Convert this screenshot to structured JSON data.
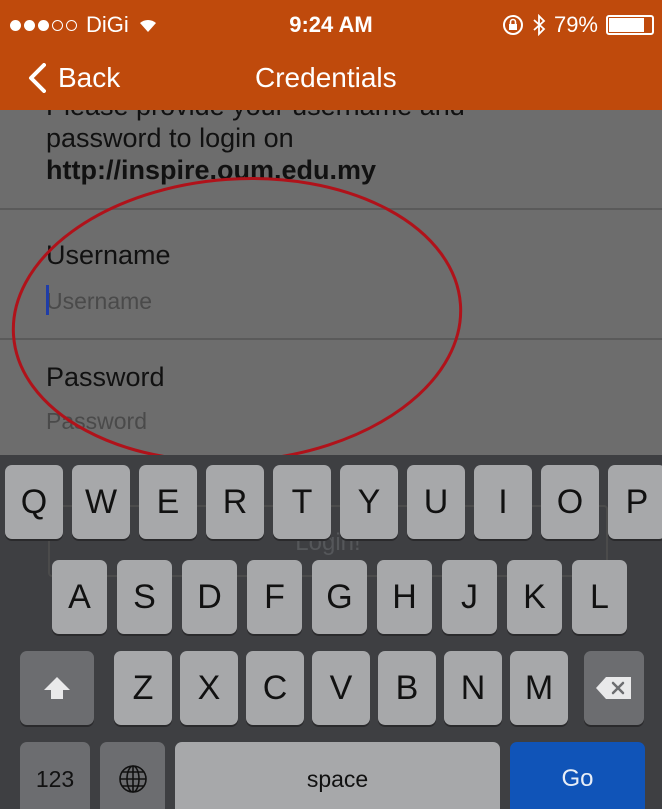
{
  "status_bar": {
    "carrier": "DiGi",
    "signal_bars_filled": 3,
    "signal_bars_total": 5,
    "time": "9:24 AM",
    "battery_percent": "79%",
    "battery_level": 0.79,
    "icons": [
      "wifi-icon",
      "rotation-lock-icon",
      "bluetooth-icon",
      "battery-icon"
    ]
  },
  "nav": {
    "back_label": "Back",
    "title": "Credentials"
  },
  "form": {
    "intro_line1": "Please provide your username and",
    "intro_line2": "password to login on",
    "intro_url": "http://inspire.oum.edu.my",
    "username_label": "Username",
    "username_placeholder": "Username",
    "password_label": "Password",
    "password_placeholder": "Password",
    "login_button": "Login!"
  },
  "annotation": {
    "color": "#b0121a"
  },
  "keyboard": {
    "row1": [
      "Q",
      "W",
      "E",
      "R",
      "T",
      "Y",
      "U",
      "I",
      "O",
      "P"
    ],
    "row2": [
      "A",
      "S",
      "D",
      "F",
      "G",
      "H",
      "J",
      "K",
      "L"
    ],
    "row3": [
      "Z",
      "X",
      "C",
      "V",
      "B",
      "N",
      "M"
    ],
    "numbers_key": "123",
    "space_key": "space",
    "go_key": "Go",
    "icons": [
      "shift-icon",
      "backspace-icon",
      "globe-icon"
    ]
  },
  "colors": {
    "accent": "#bf4a0c",
    "go_key": "#1054b8"
  }
}
